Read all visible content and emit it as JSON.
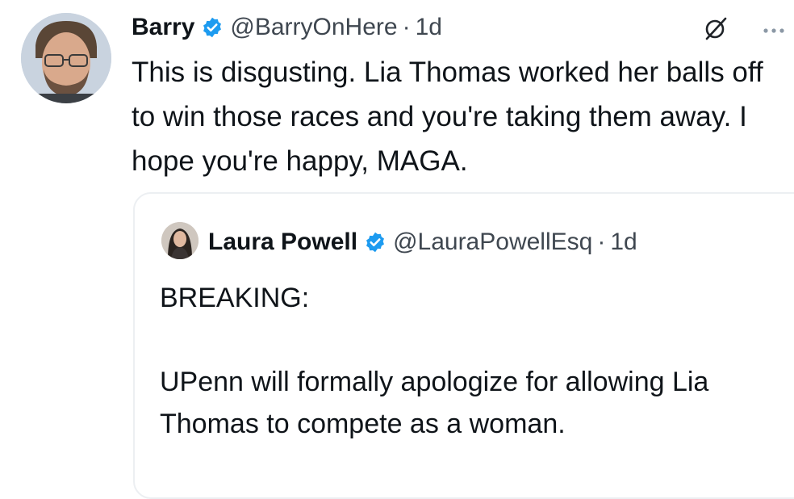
{
  "tweet": {
    "author_name": "Barry",
    "author_handle": "@BarryOnHere",
    "separator": "·",
    "time": "1d",
    "text": "This is disgusting. Lia Thomas worked her balls off to win those races and you're taking them away. I hope you're happy, MAGA.",
    "icons": {
      "verified": "verified-badge-icon",
      "grok": "grok-icon",
      "more": "more-options-icon"
    },
    "accent_color": "#1d9bf0"
  },
  "quoted_tweet": {
    "author_name": "Laura Powell",
    "author_handle": "@LauraPowellEsq",
    "separator": "·",
    "time": "1d",
    "line1": "BREAKING:",
    "line2": "UPenn will formally apologize for allowing Lia Thomas to compete as a woman."
  }
}
